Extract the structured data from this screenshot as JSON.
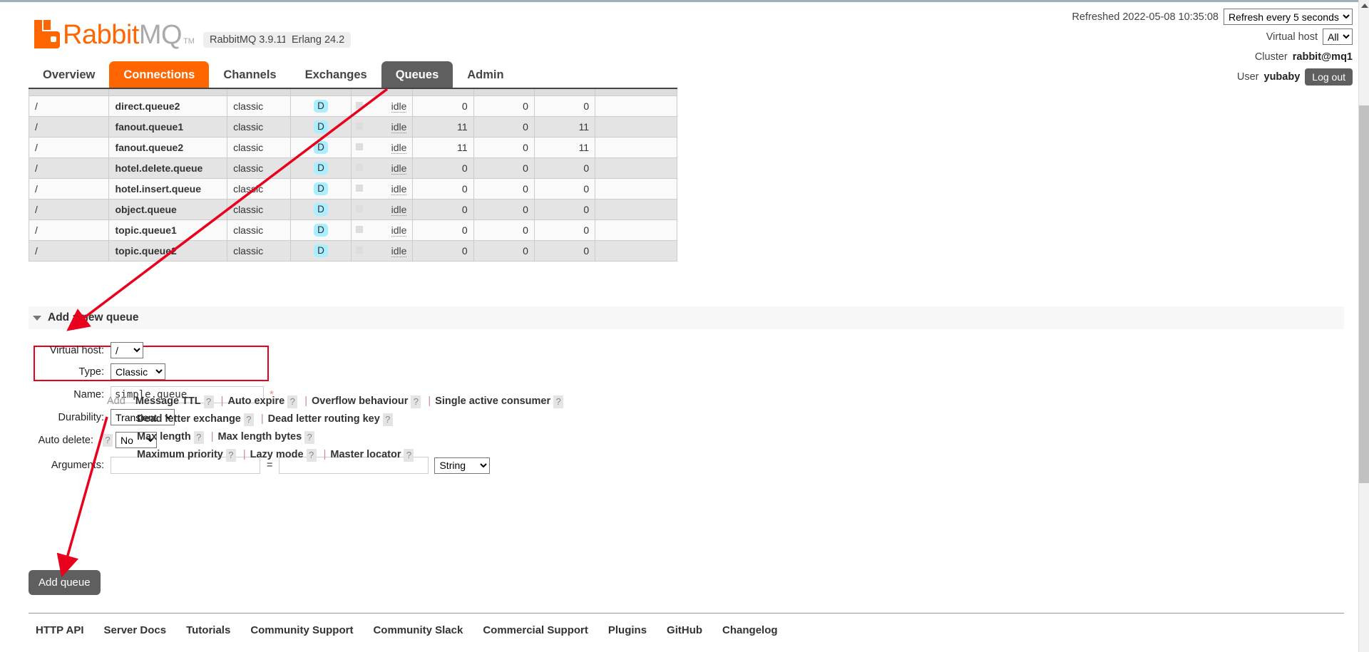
{
  "header": {
    "logo_rabbit": "Rabbit",
    "logo_mq": "MQ",
    "logo_tm": "TM",
    "version_rabbitmq": "RabbitMQ 3.9.11",
    "version_erlang": "Erlang 24.2",
    "refreshed_text": "Refreshed 2022-05-08 10:35:08",
    "refresh_select_value": "Refresh every 5 seconds",
    "refresh_options": [
      "Refresh every 5 seconds"
    ],
    "vhost_label": "Virtual host",
    "vhost_value": "All",
    "vhost_options": [
      "All"
    ],
    "cluster_label": "Cluster",
    "cluster_value": "rabbit@mq1",
    "user_label": "User",
    "user_value": "yubaby",
    "logout_label": "Log out"
  },
  "tabs": [
    {
      "label": "Overview",
      "state": "normal"
    },
    {
      "label": "Connections",
      "state": "active-orange"
    },
    {
      "label": "Channels",
      "state": "normal"
    },
    {
      "label": "Exchanges",
      "state": "normal"
    },
    {
      "label": "Queues",
      "state": "active-dark"
    },
    {
      "label": "Admin",
      "state": "normal"
    }
  ],
  "queue_table": {
    "rows": [
      {
        "vhost": "/",
        "name": "direct.queue2",
        "type": "classic",
        "features": "D",
        "state": "idle",
        "ready": "0",
        "unacked": "0",
        "total": "0",
        "blank": ""
      },
      {
        "vhost": "/",
        "name": "fanout.queue1",
        "type": "classic",
        "features": "D",
        "state": "idle",
        "ready": "11",
        "unacked": "0",
        "total": "11",
        "blank": ""
      },
      {
        "vhost": "/",
        "name": "fanout.queue2",
        "type": "classic",
        "features": "D",
        "state": "idle",
        "ready": "11",
        "unacked": "0",
        "total": "11",
        "blank": ""
      },
      {
        "vhost": "/",
        "name": "hotel.delete.queue",
        "type": "classic",
        "features": "D",
        "state": "idle",
        "ready": "0",
        "unacked": "0",
        "total": "0",
        "blank": ""
      },
      {
        "vhost": "/",
        "name": "hotel.insert.queue",
        "type": "classic",
        "features": "D",
        "state": "idle",
        "ready": "0",
        "unacked": "0",
        "total": "0",
        "blank": ""
      },
      {
        "vhost": "/",
        "name": "object.queue",
        "type": "classic",
        "features": "D",
        "state": "idle",
        "ready": "0",
        "unacked": "0",
        "total": "0",
        "blank": ""
      },
      {
        "vhost": "/",
        "name": "topic.queue1",
        "type": "classic",
        "features": "D",
        "state": "idle",
        "ready": "0",
        "unacked": "0",
        "total": "0",
        "blank": ""
      },
      {
        "vhost": "/",
        "name": "topic.queue2",
        "type": "classic",
        "features": "D",
        "state": "idle",
        "ready": "0",
        "unacked": "0",
        "total": "0",
        "blank": ""
      }
    ]
  },
  "add_queue": {
    "section_title": "Add a new queue",
    "vhost_label": "Virtual host:",
    "vhost_value": "/",
    "type_label": "Type:",
    "type_value": "Classic",
    "name_label": "Name:",
    "name_value": "simple.queue",
    "name_required_mark": "*",
    "durability_label": "Durability:",
    "durability_value": "Transient",
    "autodelete_label": "Auto delete:",
    "autodelete_help": "?",
    "autodelete_value": "No",
    "arguments_label": "Arguments:",
    "arg_key_value": "",
    "arg_key_placeholder": "",
    "arg_equals": "=",
    "arg_val_value": "",
    "arg_val_placeholder": "",
    "arg_type_value": "String",
    "add_word": "Add",
    "arg_presets": [
      {
        "label": "Message TTL",
        "help": "?"
      },
      {
        "label": "Auto expire",
        "help": "?"
      },
      {
        "label": "Overflow behaviour",
        "help": "?"
      },
      {
        "label": "Single active consumer",
        "help": "?"
      },
      {
        "label": "Dead letter exchange",
        "help": "?"
      },
      {
        "label": "Dead letter routing key",
        "help": "?"
      },
      {
        "label": "Max length",
        "help": "?"
      },
      {
        "label": "Max length bytes",
        "help": "?"
      },
      {
        "label": "Maximum priority",
        "help": "?"
      },
      {
        "label": "Lazy mode",
        "help": "?"
      },
      {
        "label": "Master locator",
        "help": "?"
      }
    ],
    "submit_label": "Add queue"
  },
  "footer": {
    "links": [
      "HTTP API",
      "Server Docs",
      "Tutorials",
      "Community Support",
      "Community Slack",
      "Commercial Support",
      "Plugins",
      "GitHub",
      "Changelog"
    ]
  },
  "colors": {
    "brand_orange": "#ff6600",
    "tab_dark": "#5f5f5f",
    "annotation_red": "#e8001c",
    "feature_badge_bg": "#aaeeff"
  }
}
